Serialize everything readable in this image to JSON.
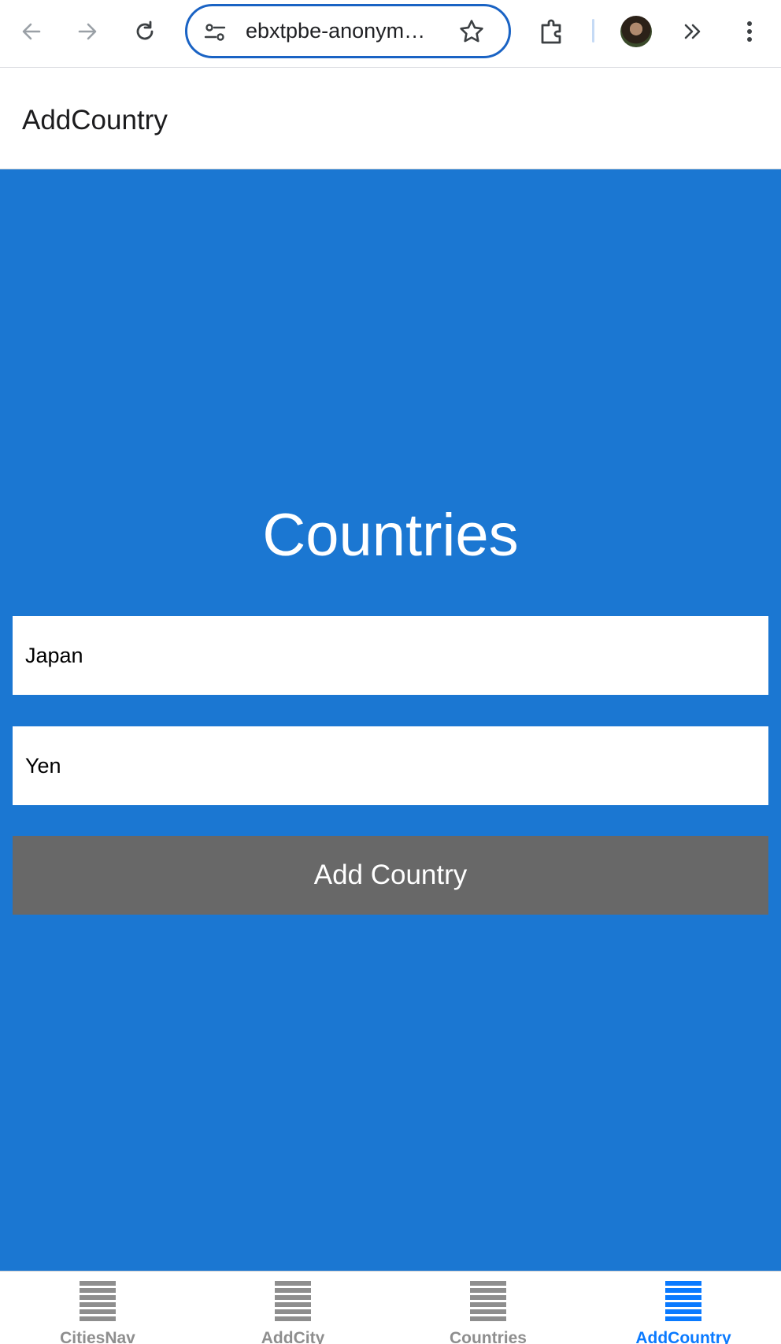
{
  "browser": {
    "url": "ebxtpbe-anonym…",
    "icons": {
      "back": "arrow-left-icon",
      "forward": "arrow-right-icon",
      "reload": "reload-icon",
      "site_settings": "tune-icon",
      "bookmark": "star-icon",
      "extensions": "puzzle-icon",
      "overflow": "chevrons-right-icon",
      "menu": "kebab-menu-icon"
    }
  },
  "header": {
    "title": "AddCountry"
  },
  "main": {
    "heading": "Countries",
    "country_name_value": "Japan",
    "currency_value": "Yen",
    "add_button_label": "Add Country",
    "colors": {
      "background": "#1b77d2",
      "button": "#686868"
    }
  },
  "tabbar": {
    "active_color": "#0a7aff",
    "inactive_color": "#8e8e8e",
    "tabs": [
      {
        "label": "CitiesNav",
        "icon": "list-icon",
        "active": false
      },
      {
        "label": "AddCity",
        "icon": "list-icon",
        "active": false
      },
      {
        "label": "Countries",
        "icon": "list-icon",
        "active": false
      },
      {
        "label": "AddCountry",
        "icon": "list-icon",
        "active": true
      }
    ]
  }
}
